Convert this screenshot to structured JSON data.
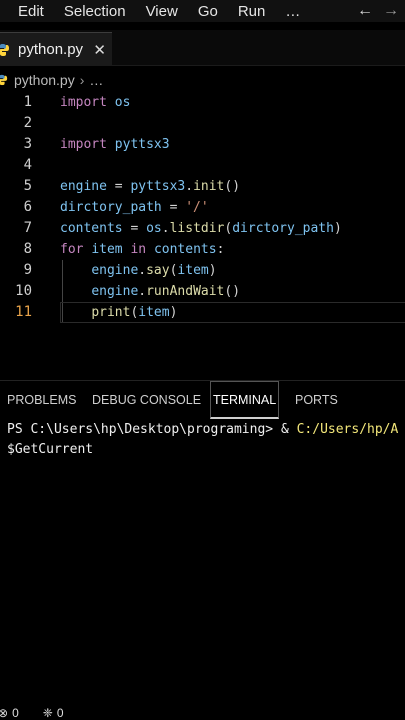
{
  "menu": {
    "items": [
      "Edit",
      "Selection",
      "View",
      "Go",
      "Run",
      "…"
    ],
    "back_icon": "arrow-left-icon",
    "forward_icon": "arrow-right-icon"
  },
  "tab": {
    "label": "python.py",
    "close": "✕",
    "icon": "python-file-icon"
  },
  "breadcrumb": {
    "file": "python.py",
    "separator": "›",
    "more": "…"
  },
  "editor": {
    "current_line": 11,
    "lines": [
      {
        "n": "1",
        "tokens": [
          [
            "kw",
            "import"
          ],
          [
            "pun",
            " "
          ],
          [
            "var",
            "os"
          ]
        ]
      },
      {
        "n": "2",
        "tokens": []
      },
      {
        "n": "3",
        "tokens": [
          [
            "kw",
            "import"
          ],
          [
            "pun",
            " "
          ],
          [
            "var",
            "pyttsx3"
          ]
        ]
      },
      {
        "n": "4",
        "tokens": []
      },
      {
        "n": "5",
        "tokens": [
          [
            "var",
            "engine"
          ],
          [
            "pun",
            " = "
          ],
          [
            "var",
            "pyttsx3"
          ],
          [
            "pun",
            "."
          ],
          [
            "fn",
            "init"
          ],
          [
            "pun",
            "()"
          ]
        ]
      },
      {
        "n": "6",
        "tokens": [
          [
            "var",
            "dirctory_path"
          ],
          [
            "pun",
            " = "
          ],
          [
            "str",
            "'/'"
          ]
        ]
      },
      {
        "n": "7",
        "tokens": [
          [
            "var",
            "contents"
          ],
          [
            "pun",
            " = "
          ],
          [
            "var",
            "os"
          ],
          [
            "pun",
            "."
          ],
          [
            "fn",
            "listdir"
          ],
          [
            "pun",
            "("
          ],
          [
            "var",
            "dirctory_path"
          ],
          [
            "pun",
            ")"
          ]
        ]
      },
      {
        "n": "8",
        "tokens": [
          [
            "kw",
            "for"
          ],
          [
            "pun",
            " "
          ],
          [
            "var",
            "item"
          ],
          [
            "pun",
            " "
          ],
          [
            "kw",
            "in"
          ],
          [
            "pun",
            " "
          ],
          [
            "var",
            "contents"
          ],
          [
            "pun",
            ":"
          ]
        ]
      },
      {
        "n": "9",
        "tokens": [
          [
            "pun",
            "    "
          ],
          [
            "var",
            "engine"
          ],
          [
            "pun",
            "."
          ],
          [
            "fn",
            "say"
          ],
          [
            "pun",
            "("
          ],
          [
            "var",
            "item"
          ],
          [
            "pun",
            ")"
          ]
        ]
      },
      {
        "n": "10",
        "tokens": [
          [
            "pun",
            "    "
          ],
          [
            "var",
            "engine"
          ],
          [
            "pun",
            "."
          ],
          [
            "fn",
            "runAndWait"
          ],
          [
            "pun",
            "()"
          ]
        ]
      },
      {
        "n": "11",
        "tokens": [
          [
            "pun",
            "    "
          ],
          [
            "fn",
            "print"
          ],
          [
            "pun",
            "("
          ],
          [
            "var",
            "item"
          ],
          [
            "pun",
            ")"
          ]
        ]
      }
    ]
  },
  "panel": {
    "tabs": [
      "PROBLEMS",
      "DEBUG CONSOLE",
      "TERMINAL",
      "PORTS"
    ],
    "active": "TERMINAL"
  },
  "terminal": {
    "prompt": "PS C:\\Users\\hp\\Desktop\\programing> ",
    "amp": "& ",
    "path": "C:/Users/hp/A",
    "line2": "$GetCurrent"
  },
  "status": {
    "errors": "0",
    "warnings": "0"
  }
}
